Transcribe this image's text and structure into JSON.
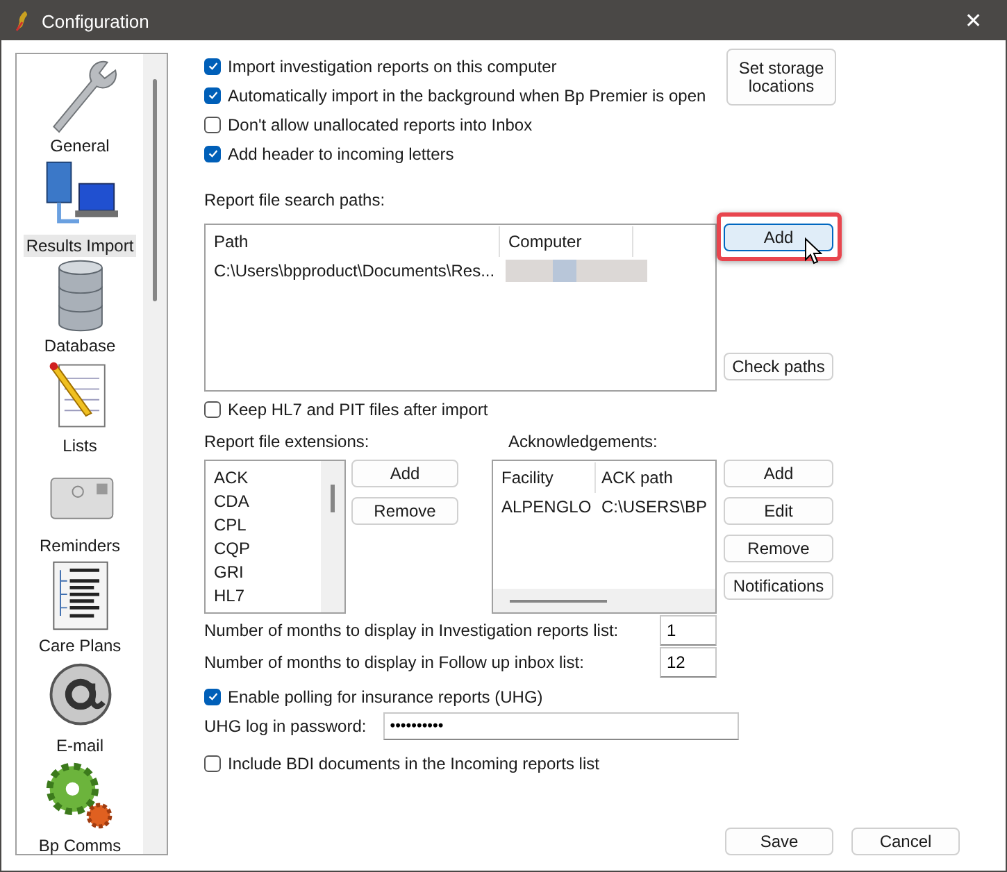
{
  "window": {
    "title": "Configuration",
    "close": "✕"
  },
  "sidebar": {
    "items": [
      {
        "label": "General",
        "selected": false
      },
      {
        "label": "Results Import",
        "selected": true
      },
      {
        "label": "Database",
        "selected": false
      },
      {
        "label": "Lists",
        "selected": false
      },
      {
        "label": "Reminders",
        "selected": false
      },
      {
        "label": "Care Plans",
        "selected": false
      },
      {
        "label": "E-mail",
        "selected": false
      },
      {
        "label": "Bp Comms",
        "selected": false
      }
    ]
  },
  "options": [
    {
      "label": "Import investigation reports on this computer",
      "checked": true
    },
    {
      "label": "Automatically import in the background when Bp Premier is open",
      "checked": true
    },
    {
      "label": "Don't allow unallocated reports into Inbox",
      "checked": false
    },
    {
      "label": "Add header to incoming letters",
      "checked": true
    }
  ],
  "storage_button": "Set storage\nlocations",
  "search_paths": {
    "label": "Report file search paths:",
    "columns": [
      "Path",
      "Computer"
    ],
    "rows": [
      {
        "path": "C:\\Users\\bpproduct\\Documents\\Res..."
      }
    ],
    "buttons": [
      {
        "label": "Add",
        "highlighted": true
      },
      {
        "label": "Check paths",
        "highlighted": false
      }
    ]
  },
  "keep_files": {
    "label": "Keep HL7 and PIT files after import",
    "checked": false
  },
  "extensions": {
    "label": "Report file extensions:",
    "items": [
      "ACK",
      "CDA",
      "CPL",
      "CQP",
      "GRI",
      "HL7"
    ],
    "buttons": [
      "Add",
      "Remove"
    ]
  },
  "acknowledgements": {
    "label": "Acknowledgements:",
    "columns": [
      "Facility",
      "ACK path"
    ],
    "rows": [
      {
        "facility": "ALPENGLO",
        "path": "C:\\USERS\\BP"
      }
    ],
    "buttons": [
      "Add",
      "Edit",
      "Remove",
      "Notifications"
    ]
  },
  "months": [
    {
      "label": "Number of months to display in Investigation reports list:",
      "value": "1"
    },
    {
      "label": "Number of months to display in Follow up inbox list:",
      "value": "12"
    }
  ],
  "polling": {
    "label": "Enable polling for insurance reports (UHG)",
    "checked": true
  },
  "password": {
    "label": "UHG log in password:",
    "value": "••••••••••"
  },
  "include_bdi": {
    "label": "Include BDI documents in the Incoming reports list",
    "checked": false
  },
  "footer": {
    "buttons": [
      "Save",
      "Cancel"
    ]
  }
}
